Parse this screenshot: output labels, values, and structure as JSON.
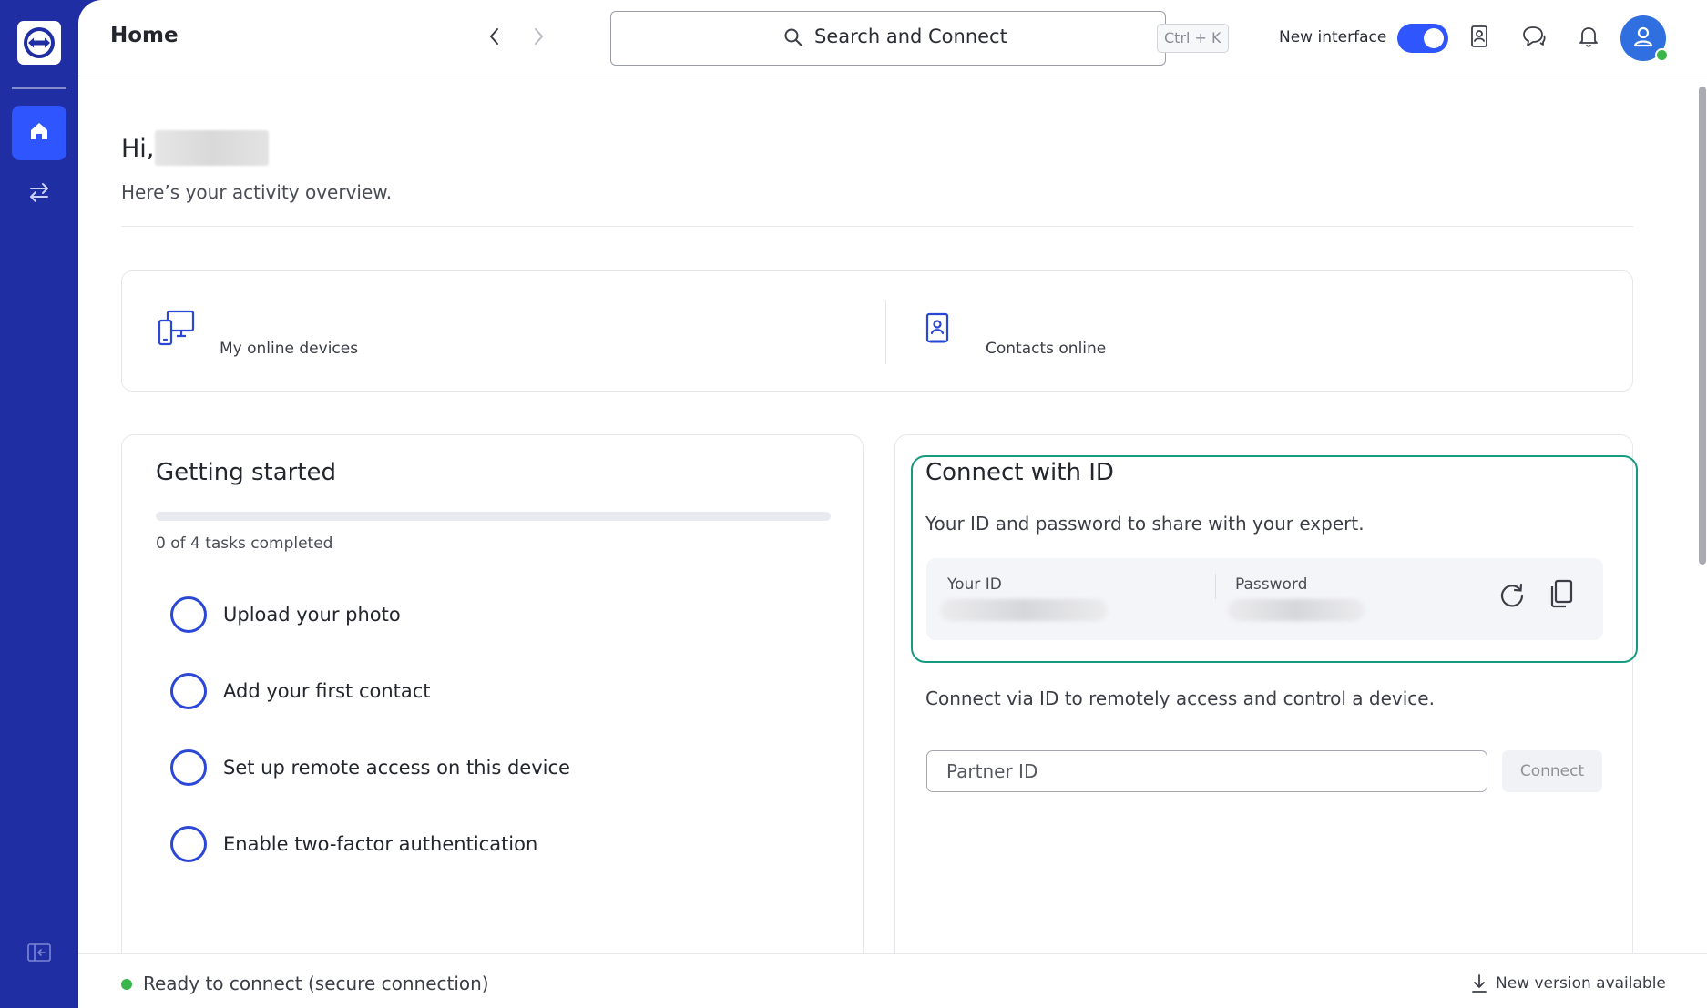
{
  "header": {
    "title": "Home",
    "search_placeholder": "Search and Connect",
    "search_shortcut": "Ctrl + K",
    "new_interface_label": "New interface",
    "new_interface_enabled": true
  },
  "greeting": {
    "hello": "Hi,",
    "subtitle": "Here’s your activity overview."
  },
  "stats": {
    "devices_label": "My online devices",
    "contacts_label": "Contacts online"
  },
  "getting_started": {
    "title": "Getting started",
    "progress_fraction": 0,
    "count_text": "0 of 4 tasks completed",
    "tasks": [
      {
        "label": "Upload your photo",
        "done": false
      },
      {
        "label": "Add your first contact",
        "done": false
      },
      {
        "label": "Set up remote access on this device",
        "done": false
      },
      {
        "label": "Enable two-factor authentication",
        "done": false
      }
    ]
  },
  "connect_with_id": {
    "title": "Connect with ID",
    "subtitle": "Your ID and password to share with your expert.",
    "your_id_label": "Your ID",
    "password_label": "Password",
    "description": "Connect via ID to remotely access and control a device.",
    "partner_placeholder": "Partner ID",
    "connect_label": "Connect"
  },
  "status": {
    "text": "Ready to connect (secure connection)",
    "update_text": "New version available"
  },
  "colors": {
    "sidebar": "#1f2fa3",
    "accent": "#2f55ff",
    "highlight": "#169a80",
    "online": "#3ab54a"
  },
  "icons": {
    "logo": "teamviewer-logo-icon",
    "home": "home-icon",
    "transfer": "transfer-icon",
    "collapse": "collapse-sidebar-icon",
    "back": "chevron-left-icon",
    "forward": "chevron-right-icon",
    "search": "search-icon",
    "contacts": "contact-book-icon",
    "chat": "chat-icon",
    "notifications": "bell-icon",
    "user": "user-icon",
    "devices": "devices-icon",
    "refresh": "refresh-icon",
    "copy": "copy-icon",
    "download": "download-icon"
  }
}
